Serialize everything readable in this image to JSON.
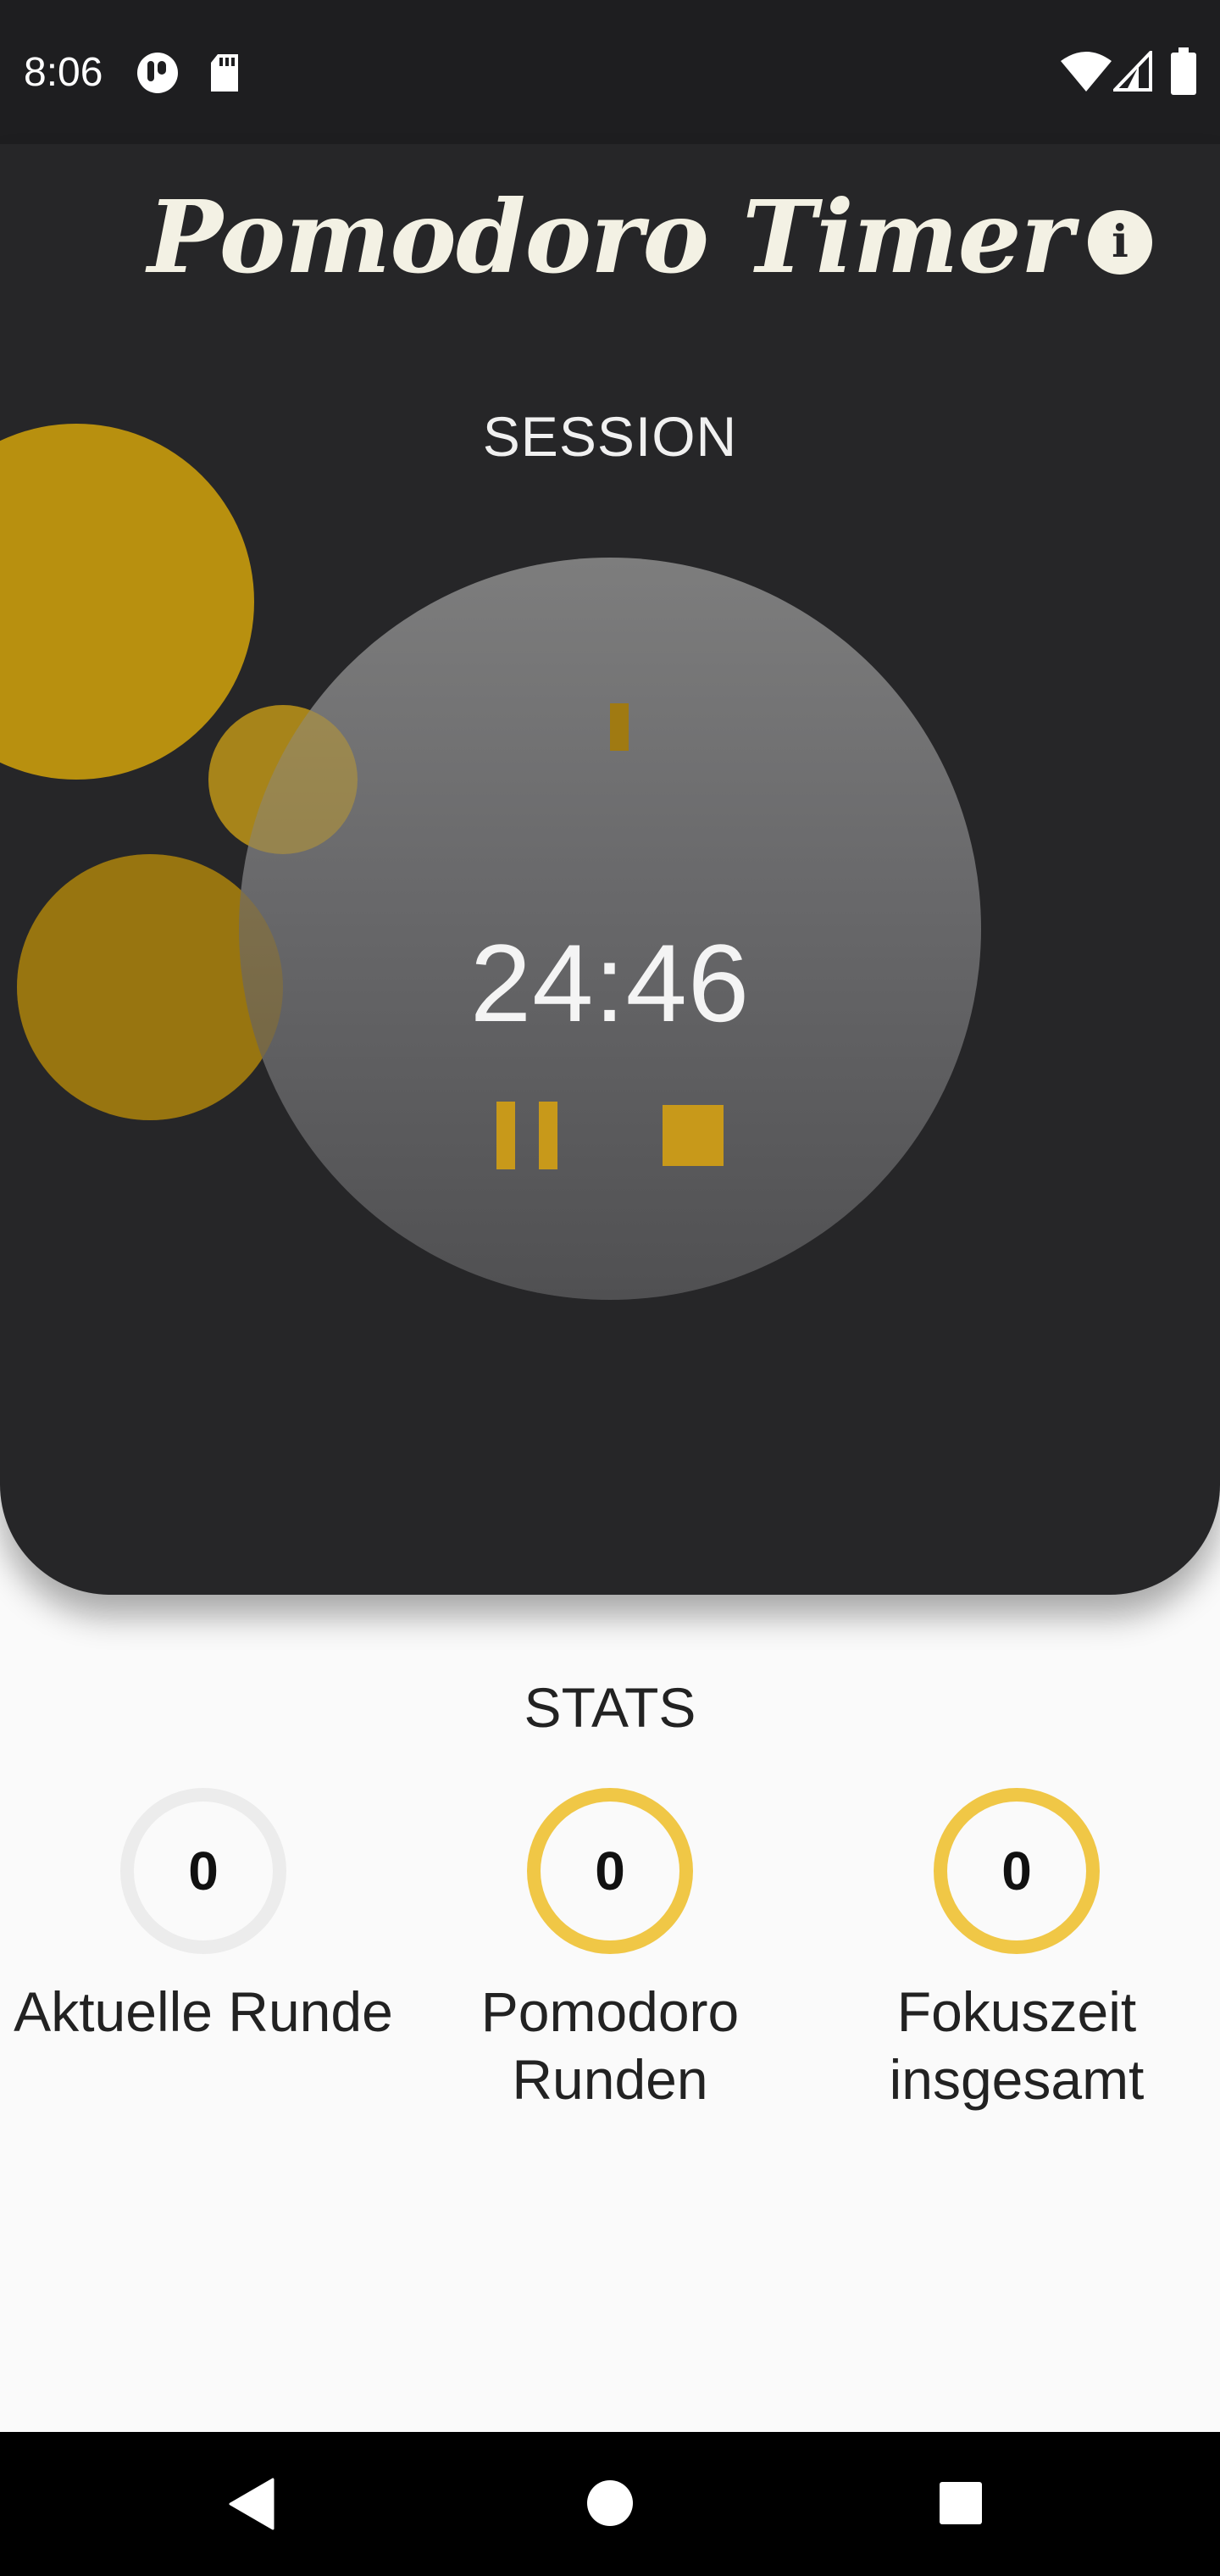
{
  "status_bar": {
    "time": "8:06",
    "left_icons": [
      "half-circle-app-icon",
      "sd-card-icon"
    ],
    "right_icons": [
      "wifi-icon",
      "cell-signal-icon",
      "battery-icon"
    ]
  },
  "header": {
    "title": "Pomodoro Timer",
    "info_icon": "info-icon",
    "info_glyph": "i"
  },
  "session": {
    "label": "SESSION",
    "time_remaining": "24:46",
    "controls": {
      "pause_icon": "pause-icon",
      "stop_icon": "stop-icon"
    }
  },
  "stats": {
    "label": "STATS",
    "items": [
      {
        "value": "0",
        "caption_lines": [
          "Aktuelle Runde"
        ],
        "active": false
      },
      {
        "value": "0",
        "caption_lines": [
          "Pomodoro",
          "Runden"
        ],
        "active": true
      },
      {
        "value": "0",
        "caption_lines": [
          "Fokuszeit",
          "insgesamt"
        ],
        "active": true
      }
    ]
  },
  "nav_bar": {
    "icons": [
      "back-triangle-icon",
      "home-circle-icon",
      "recents-square-icon"
    ]
  },
  "colors": {
    "dark_panel": "#262628",
    "accent_gold": "#c8991a",
    "ring_yellow": "#f0c746",
    "title_cream": "#f3f1e4",
    "background": "#fafafa"
  }
}
